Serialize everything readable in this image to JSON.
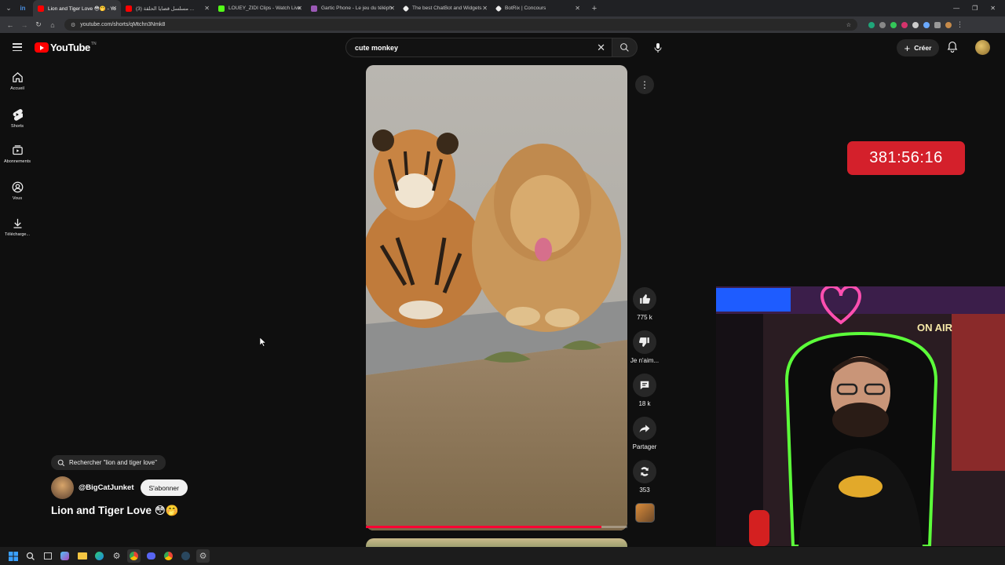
{
  "browser": {
    "tabs": [
      {
        "label": "Lion and Tiger Love 😳🤭 - Yo",
        "color": "#ff0000",
        "active": true
      },
      {
        "label": "مسلسل قضايا الحلقة (3) ...",
        "color": "#ff0000",
        "active": false
      },
      {
        "label": "LOUEY_ZIDI Clips - Watch Live",
        "color": "#53fc18",
        "active": false
      },
      {
        "label": "Gartic Phone - Le jeu du téléph",
        "color": "#9b59b6",
        "active": false
      },
      {
        "label": "The best ChatBot and Widgets",
        "color": "#ffffff",
        "active": false
      },
      {
        "label": "BotRix | Concours",
        "color": "#ffffff",
        "active": false
      }
    ],
    "url": "youtube.com/shorts/qMtchn3Nmk8"
  },
  "youtube": {
    "logo_text": "YouTube",
    "region": "TN",
    "search_value": "cute monkey",
    "create_label": "Créer"
  },
  "left_nav": [
    {
      "label": "Accueil",
      "icon": "home-icon"
    },
    {
      "label": "Shorts",
      "icon": "shorts-icon"
    },
    {
      "label": "Abonnements",
      "icon": "subscriptions-icon"
    },
    {
      "label": "Vous",
      "icon": "you-icon"
    },
    {
      "label": "Télécharge...",
      "icon": "download-icon"
    }
  ],
  "short": {
    "progress": 0.9,
    "likes": "775 k",
    "dislike_label": "Je n'aim...",
    "comments": "18 k",
    "share_label": "Partager",
    "remix": "353",
    "search_suggestion": "Rechercher \"lion and tiger love\"",
    "channel": "@BigCatJunket",
    "subscribe_label": "S'abonner",
    "title": "Lion and Tiger Love 😳🤭"
  },
  "overlay": {
    "timer": "381:56:16",
    "webcam_sign": "ON AIR"
  },
  "colors": {
    "accent": "#ff0000",
    "timer_bg": "#d4202b"
  }
}
